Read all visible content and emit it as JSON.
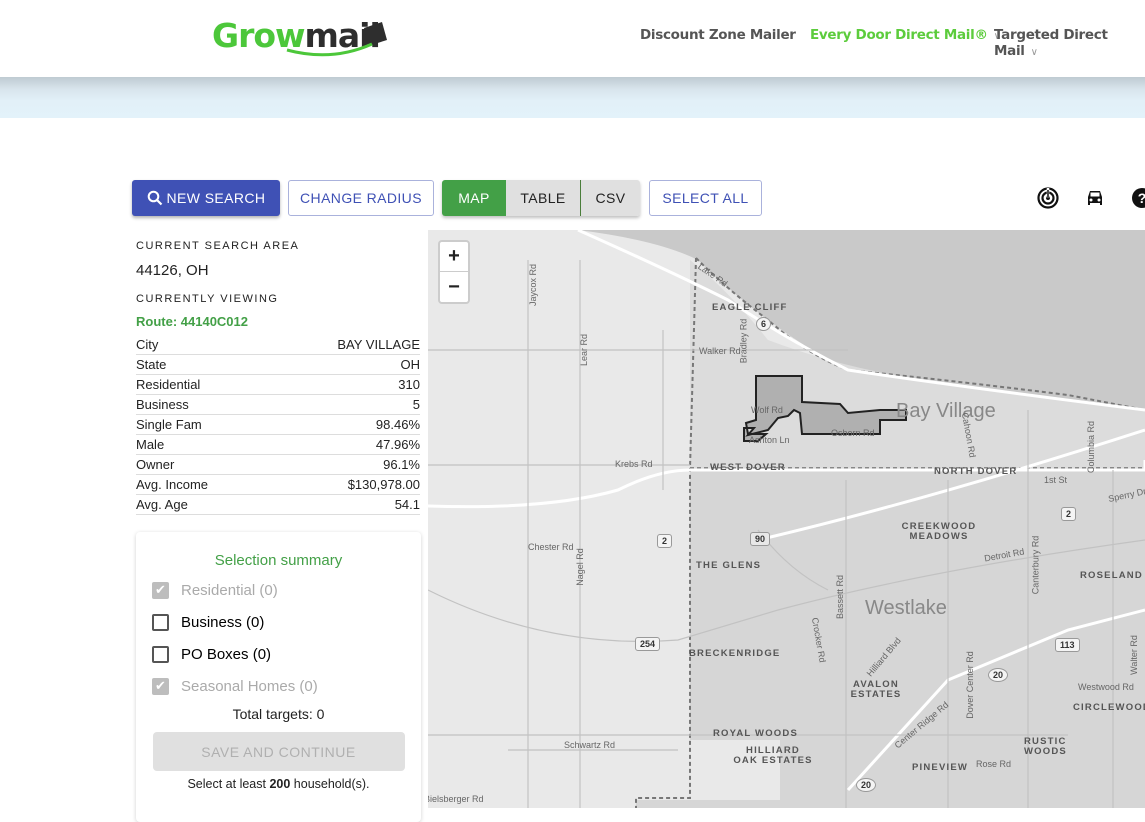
{
  "header": {
    "logo_part1": "Grow",
    "logo_part2": "mail",
    "nav": [
      {
        "label": "Discount Zone Mailer",
        "active": false,
        "has_dropdown": false
      },
      {
        "label": "Every Door Direct Mail®",
        "active": true,
        "has_dropdown": true
      },
      {
        "label": "Targeted Direct Mail",
        "active": false,
        "has_dropdown": true
      }
    ]
  },
  "toolbar": {
    "new_search": "NEW SEARCH",
    "change_radius": "CHANGE RADIUS",
    "view_toggle": [
      {
        "label": "MAP",
        "selected": true
      },
      {
        "label": "TABLE",
        "selected": false
      },
      {
        "label": "CSV",
        "selected": false
      }
    ],
    "select_all": "SELECT ALL",
    "icons": [
      "radar-icon",
      "car-icon",
      "help-icon"
    ]
  },
  "left_panel": {
    "search_area_label": "CURRENT SEARCH AREA",
    "search_area": "44126, OH",
    "viewing_label": "CURRENTLY VIEWING",
    "route": "Route: 44140C012",
    "stats": [
      {
        "label": "City",
        "value": "BAY VILLAGE"
      },
      {
        "label": "State",
        "value": "OH"
      },
      {
        "label": "Residential",
        "value": "310"
      },
      {
        "label": "Business",
        "value": "5"
      },
      {
        "label": "Single Fam",
        "value": "98.46%"
      },
      {
        "label": "Male",
        "value": "47.96%"
      },
      {
        "label": "Owner",
        "value": "96.1%"
      },
      {
        "label": "Avg. Income",
        "value": "$130,978.00"
      },
      {
        "label": "Avg. Age",
        "value": "54.1"
      }
    ]
  },
  "summary": {
    "title": "Selection summary",
    "options": [
      {
        "label": "Residential (0)",
        "checked": true,
        "disabled": true
      },
      {
        "label": "Business (0)",
        "checked": false,
        "disabled": false
      },
      {
        "label": "PO Boxes (0)",
        "checked": false,
        "disabled": false
      },
      {
        "label": "Seasonal Homes (0)",
        "checked": true,
        "disabled": true
      }
    ],
    "total": "Total targets: 0",
    "save_button": "SAVE AND CONTINUE",
    "hint_pre": "Select at least ",
    "hint_num": "200",
    "hint_post": " household(s)."
  },
  "map": {
    "zoom_in": "+",
    "zoom_out": "−",
    "cities": [
      "Bay Village",
      "Westlake"
    ],
    "places": [
      "EAGLE CLIFF",
      "WEST DOVER",
      "NORTH DOVER",
      "CREEKWOOD MEADOWS",
      "THE GLENS",
      "ROSELAND",
      "BRECKENRIDGE",
      "AVALON ESTATES",
      "ROYAL WOODS",
      "HILLIARD OAK ESTATES",
      "CIRCLEWOOD",
      "RUSTIC WOODS",
      "PINEVIEW"
    ],
    "roads": [
      "Lake Rd",
      "Jaycox Rd",
      "Lear Rd",
      "Walker Rd",
      "Bradley Rd",
      "Wolf Rd",
      "Ashton Ln",
      "Osborn Rd",
      "Krebs Rd",
      "Cahoon Rd",
      "Columbia Rd",
      "1st St",
      "Sperry Dr",
      "Detroit Rd",
      "Chester Rd",
      "Nagel Rd",
      "Bassett Rd",
      "Canterbury Rd",
      "Center Ridge Rd",
      "Hilliard Blvd",
      "Dover Center Rd",
      "Crocker Rd",
      "Westwood Rd",
      "Walter Rd",
      "Schwartz Rd",
      "Rose Rd",
      "Bielsberger Rd"
    ],
    "shields": [
      "6",
      "2",
      "90",
      "2",
      "254",
      "113",
      "20",
      "20"
    ]
  }
}
